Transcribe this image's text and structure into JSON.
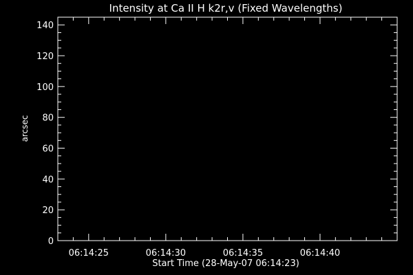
{
  "chart_data": {
    "type": "line",
    "title": "Intensity at Ca II H k2r,v (Fixed Wavelengths)",
    "xlabel": "Start Time (28-May-07 06:14:23)",
    "ylabel": "arcsec",
    "ylim": [
      0,
      145
    ],
    "yticks": [
      0,
      20,
      40,
      60,
      80,
      100,
      120,
      140
    ],
    "y_minor_step": 5,
    "x_start_seconds": 23,
    "xlim_seconds": [
      23,
      45
    ],
    "xticks": [
      {
        "seconds": 25,
        "label": "06:14:25"
      },
      {
        "seconds": 30,
        "label": "06:14:30"
      },
      {
        "seconds": 35,
        "label": "06:14:35"
      },
      {
        "seconds": 40,
        "label": "06:14:40"
      }
    ],
    "x_minor_step_seconds": 1,
    "series": [],
    "background_color": "#000000",
    "axis_color": "#ffffff",
    "grid": false
  }
}
